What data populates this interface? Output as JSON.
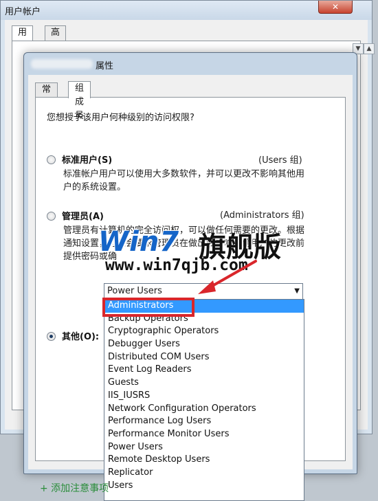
{
  "background_window": {
    "title": "用户帐户",
    "tabs": [
      "用户",
      "高级"
    ],
    "close_label": "✕"
  },
  "dialog": {
    "title": "属性",
    "tabs": [
      "常规",
      "组成员"
    ],
    "question": "您想授予该用户何种级别的访问权限?",
    "options": [
      {
        "label": "标准用户(S)",
        "group": "(Users 组)",
        "desc_lines": [
          "标准帐户用户可以使用大多数软件，并可以更改不影响其他用",
          "户的系统设置。"
        ],
        "checked": false
      },
      {
        "label": "管理员(A)",
        "group": "(Administrators 组)",
        "desc_lines": [
          "管理员有计算机的完全访问权，可以做任何需要的更改。根据",
          "通知设置，可能会要求管理员在做出会影响其他用户的更改前",
          "提供密码或确"
        ],
        "checked": false
      },
      {
        "label": "其他(O):",
        "checked": true
      }
    ],
    "combo_value": "Power Users",
    "list_items": [
      "Administrators",
      "Backup Operators",
      "Cryptographic Operators",
      "Debugger Users",
      "Distributed COM Users",
      "Event Log Readers",
      "Guests",
      "IIS_IUSRS",
      "Network Configuration Operators",
      "Performance Log Users",
      "Performance Monitor Users",
      "Power Users",
      "Remote Desktop Users",
      "Replicator",
      "Users"
    ],
    "selected_item": "Administrators"
  },
  "watermark": {
    "logo": "Win7",
    "cn": "旗舰版",
    "url": "www.win7qjb.com"
  },
  "bottom_link": "+ 添加注意事项",
  "colors": {
    "highlight_box": "#d9262b",
    "selection": "#3399ff",
    "watermark_blue": "#1565c8"
  }
}
